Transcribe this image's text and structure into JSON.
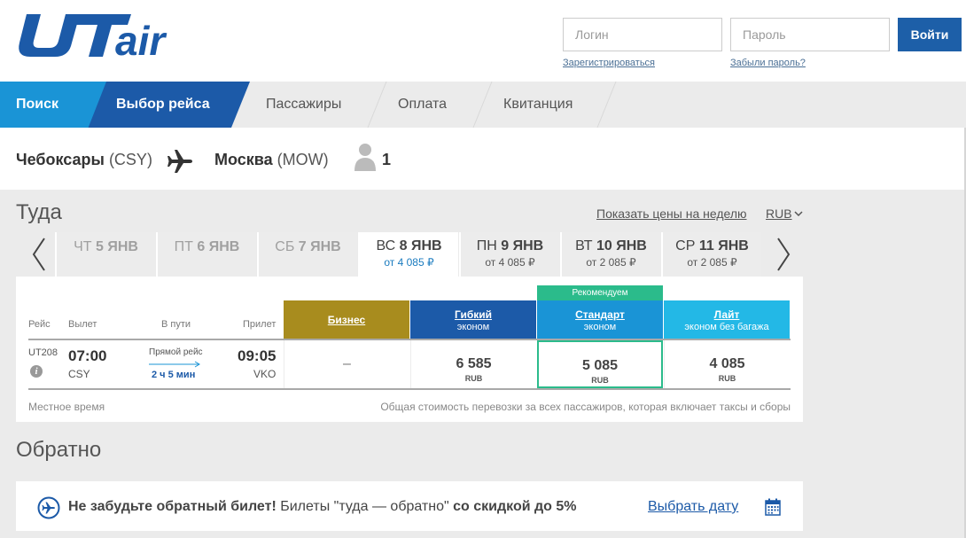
{
  "header": {
    "logo_text": "UTair",
    "login_placeholder": "Логин",
    "password_placeholder": "Пароль",
    "login_button": "Войти",
    "register_link": "Зарегистрироваться",
    "forgot_link": "Забыли пароль?"
  },
  "steps": [
    "Поиск",
    "Выбор рейса",
    "Пассажиры",
    "Оплата",
    "Квитанция"
  ],
  "route": {
    "from_city": "Чебоксары",
    "from_code": "(CSY)",
    "to_city": "Москва",
    "to_code": "(MOW)",
    "passengers": "1"
  },
  "outbound": {
    "title": "Туда",
    "week_link": "Показать цены на неделю",
    "currency": "RUB",
    "dates": [
      {
        "day": "ЧТ",
        "date": "5 ЯНВ",
        "price": ""
      },
      {
        "day": "ПТ",
        "date": "6 ЯНВ",
        "price": ""
      },
      {
        "day": "СБ",
        "date": "7 ЯНВ",
        "price": ""
      },
      {
        "day": "ВС",
        "date": "8 ЯНВ",
        "price": "от 4 085 ₽"
      },
      {
        "day": "ПН",
        "date": "9 ЯНВ",
        "price": "от 4 085 ₽"
      },
      {
        "day": "ВТ",
        "date": "10 ЯНВ",
        "price": "от 2 085 ₽"
      },
      {
        "day": "СР",
        "date": "11 ЯНВ",
        "price": "от 2 085 ₽"
      }
    ],
    "columns": {
      "flight": "Рейс",
      "departure": "Вылет",
      "duration": "В пути",
      "arrival": "Прилет"
    },
    "recommended": "Рекомендуем",
    "fares": [
      {
        "name": "Бизнес",
        "sub": ""
      },
      {
        "name": "Гибкий",
        "sub": "эконом"
      },
      {
        "name": "Стандарт",
        "sub": "эконом"
      },
      {
        "name": "Лайт",
        "sub": "эконом без багажа"
      }
    ],
    "flight": {
      "number": "UT208",
      "dep_time": "07:00",
      "dep_code": "CSY",
      "direct": "Прямой рейс",
      "duration": "2 ч 5 мин",
      "arr_time": "09:05",
      "arr_code": "VKO",
      "prices": [
        {
          "value": "–",
          "currency": ""
        },
        {
          "value": "6 585",
          "currency": "RUB"
        },
        {
          "value": "5 085",
          "currency": "RUB"
        },
        {
          "value": "4 085",
          "currency": "RUB"
        }
      ]
    },
    "local_time": "Местное время",
    "total_note": "Общая стоимость перевозки за всех пассажиров, которая включает таксы и сборы"
  },
  "return": {
    "title": "Обратно",
    "banner_bold1": "Не забудьте обратный билет!",
    "banner_text": " Билеты \"туда — обратно\" ",
    "banner_bold2": "со скидкой до 5%",
    "pick_date": "Выбрать дату"
  },
  "colors": {
    "brand_dark": "#1c5aa8",
    "brand_light": "#1a94d6",
    "business": "#a88c1e",
    "lite": "#23b8e6",
    "recommended": "#2bbb8b"
  }
}
